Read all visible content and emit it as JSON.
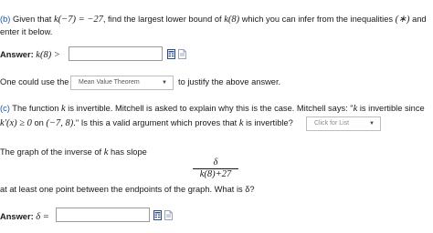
{
  "part_b": {
    "label": "(b)",
    "text_a": "Given that",
    "given": "k(−7) = −27",
    "text_b": ", find the largest lower bound of",
    "fn": "k(8)",
    "text_c": "which you can infer from the inequalities",
    "star": "(∗)",
    "text_d": "and",
    "line2": "enter it below.",
    "answer_label": "Answer:",
    "answer_expr": "k(8) >",
    "input_value": "",
    "sentence_start": "One could use the",
    "theorem_selected": "Mean Value Theorem",
    "sentence_end": "to justify the above answer."
  },
  "part_c": {
    "label": "(c)",
    "text_a": "The function",
    "k1": "k",
    "text_b": "is invertible. Mitchell is asked to explain why this is the case. Mitchell says: \"",
    "k2": "k",
    "text_c": "is invertible since",
    "deriv": "k′(x) ≥ 0",
    "on": "on",
    "interval": "(−7, 8)",
    "text_d": ".\" Is this a valid argument which proves that",
    "k3": "k",
    "text_e": "is invertible?",
    "dropdown_placeholder": "Click for List",
    "graph_text_a": "The graph of the inverse of",
    "graph_k": "k",
    "graph_text_b": "has slope",
    "frac_num": "δ",
    "frac_den": "k(8)+27",
    "graph_line2": "at at least one point between the endpoints of the graph. What is δ?",
    "answer_label": "Answer:",
    "answer_expr": "δ =",
    "input_value": ""
  },
  "icons": [
    "spreadsheet-icon",
    "paste-document-icon"
  ],
  "colors": {
    "label_blue": "#1a55a6",
    "icon_blue": "#2b4a8a"
  }
}
